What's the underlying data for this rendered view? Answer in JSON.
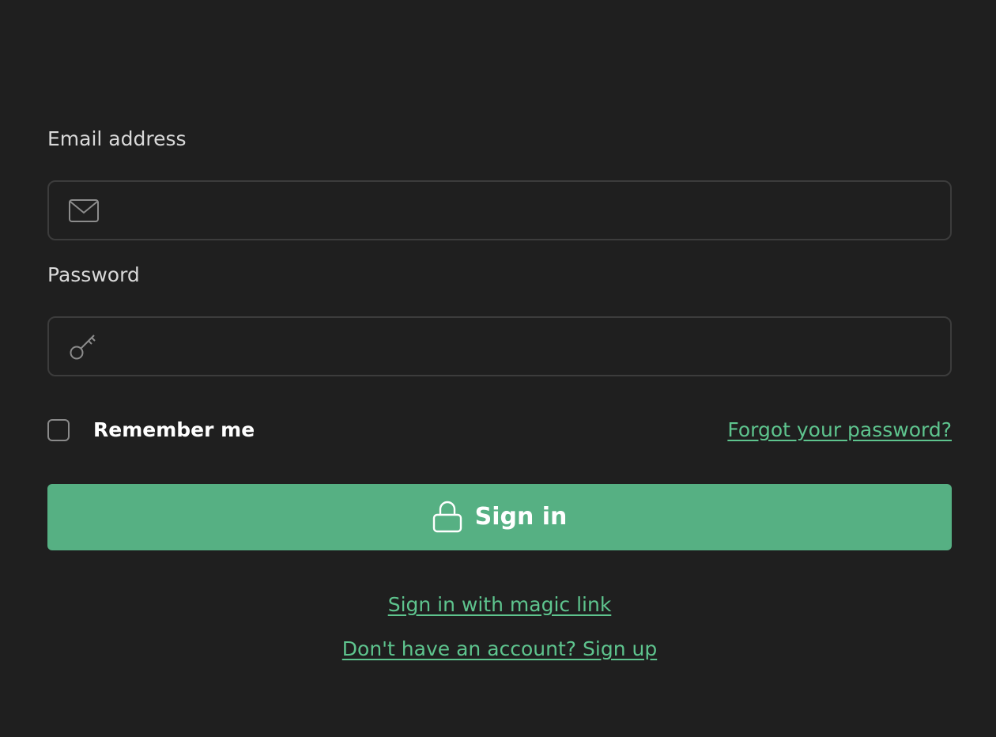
{
  "email": {
    "label": "Email address",
    "value": "",
    "icon": "mail-icon"
  },
  "password": {
    "label": "Password",
    "value": "",
    "icon": "key-icon"
  },
  "remember": {
    "label": "Remember me",
    "checked": false
  },
  "forgot_link": "Forgot your password?",
  "signin_button": {
    "label": "Sign in",
    "icon": "lock-icon",
    "color": "#56b083"
  },
  "magic_link": "Sign in with magic link",
  "signup_link": "Don't have an account? Sign up",
  "colors": {
    "background": "#1f1f1f",
    "accent": "#5ec48e",
    "field_border": "#3c3c3c"
  }
}
